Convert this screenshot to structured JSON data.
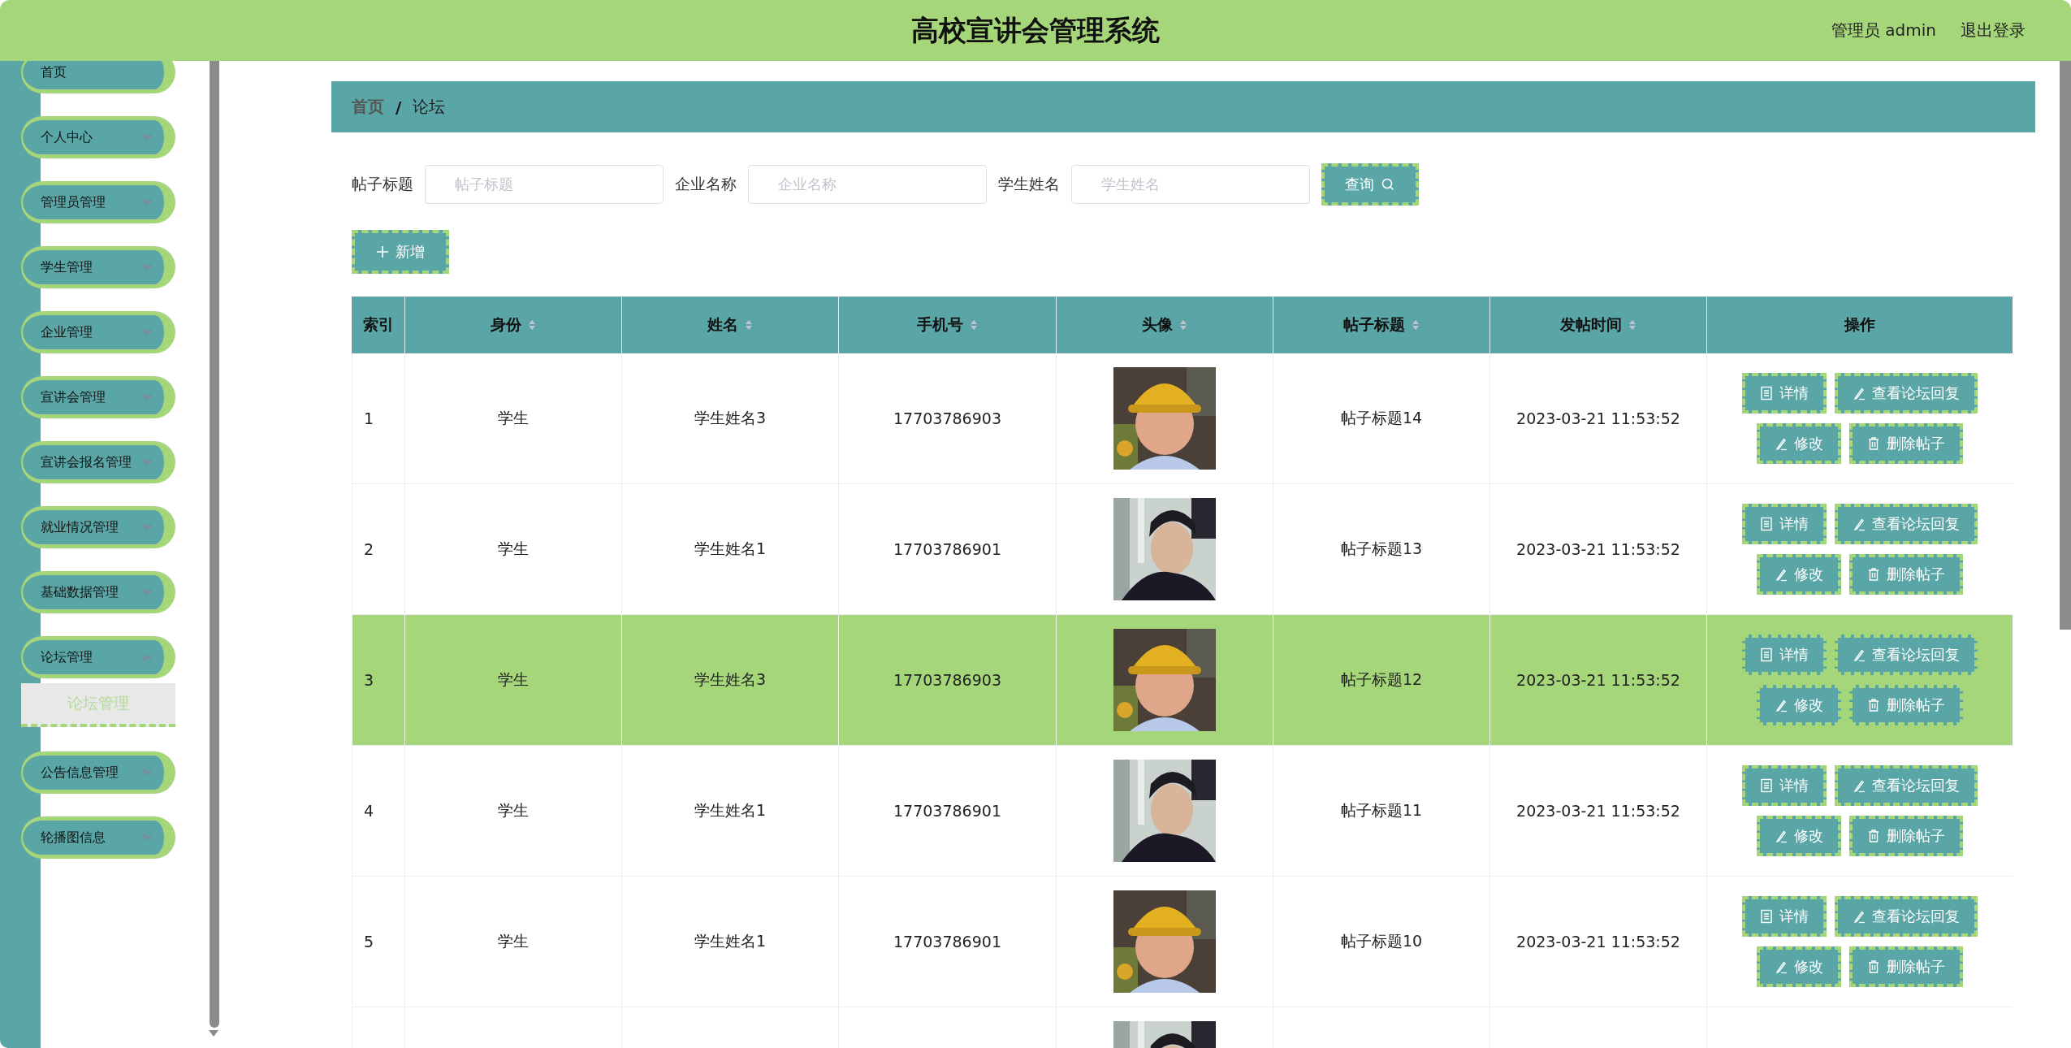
{
  "header": {
    "title": "高校宣讲会管理系统",
    "user": "管理员 admin",
    "logout": "退出登录"
  },
  "sidebar": {
    "items": [
      {
        "label": "首页",
        "kind": "link"
      },
      {
        "label": "个人中心",
        "kind": "menu",
        "expanded": false
      },
      {
        "label": "管理员管理",
        "kind": "menu",
        "expanded": false
      },
      {
        "label": "学生管理",
        "kind": "menu",
        "expanded": false
      },
      {
        "label": "企业管理",
        "kind": "menu",
        "expanded": false
      },
      {
        "label": "宣讲会管理",
        "kind": "menu",
        "expanded": false
      },
      {
        "label": "宣讲会报名管理",
        "kind": "menu",
        "expanded": false
      },
      {
        "label": "就业情况管理",
        "kind": "menu",
        "expanded": false
      },
      {
        "label": "基础数据管理",
        "kind": "menu",
        "expanded": false
      },
      {
        "label": "论坛管理",
        "kind": "menu",
        "expanded": true,
        "children": [
          {
            "label": "论坛管理",
            "selected": true
          }
        ]
      },
      {
        "label": "公告信息管理",
        "kind": "menu",
        "expanded": false
      },
      {
        "label": "轮播图信息",
        "kind": "menu",
        "expanded": false
      }
    ]
  },
  "breadcrumb": {
    "items": [
      "首页",
      "论坛"
    ],
    "separator": "/"
  },
  "search": {
    "fields": [
      {
        "label": "帖子标题",
        "placeholder": "帖子标题"
      },
      {
        "label": "企业名称",
        "placeholder": "企业名称"
      },
      {
        "label": "学生姓名",
        "placeholder": "学生姓名"
      }
    ],
    "button": "查询"
  },
  "add_button": "新增",
  "table": {
    "columns": [
      {
        "label": "索引",
        "sortable": false
      },
      {
        "label": "身份",
        "sortable": true
      },
      {
        "label": "姓名",
        "sortable": true
      },
      {
        "label": "手机号",
        "sortable": true
      },
      {
        "label": "头像",
        "sortable": true
      },
      {
        "label": "帖子标题",
        "sortable": true
      },
      {
        "label": "发帖时间",
        "sortable": true
      },
      {
        "label": "操作",
        "sortable": false
      }
    ],
    "rows": [
      {
        "index": "1",
        "role": "学生",
        "name": "学生姓名3",
        "phone": "17703786903",
        "title": "帖子标题14",
        "time": "2023-03-21 11:53:52",
        "selected": false,
        "actions": [
          {
            "label": "详情",
            "kind": "detail"
          },
          {
            "label": "查看论坛回复",
            "kind": "edit"
          },
          {
            "label": "修改",
            "kind": "edit"
          },
          {
            "label": "删除帖子",
            "kind": "delete"
          }
        ]
      },
      {
        "index": "2",
        "role": "学生",
        "name": "学生姓名1",
        "phone": "17703786901",
        "title": "帖子标题13",
        "time": "2023-03-21 11:53:52",
        "selected": false,
        "actions": [
          {
            "label": "详情",
            "kind": "detail"
          },
          {
            "label": "查看论坛回复",
            "kind": "edit"
          },
          {
            "label": "修改",
            "kind": "edit"
          },
          {
            "label": "删除帖子",
            "kind": "delete"
          }
        ]
      },
      {
        "index": "3",
        "role": "学生",
        "name": "学生姓名3",
        "phone": "17703786903",
        "title": "帖子标题12",
        "time": "2023-03-21 11:53:52",
        "selected": true,
        "actions": [
          {
            "label": "详情",
            "kind": "detail"
          },
          {
            "label": "查看论坛回复",
            "kind": "edit"
          },
          {
            "label": "修改",
            "kind": "edit"
          },
          {
            "label": "删除帖子",
            "kind": "delete"
          }
        ]
      },
      {
        "index": "4",
        "role": "学生",
        "name": "学生姓名1",
        "phone": "17703786901",
        "title": "帖子标题11",
        "time": "2023-03-21 11:53:52",
        "selected": false,
        "actions": [
          {
            "label": "详情",
            "kind": "detail"
          },
          {
            "label": "查看论坛回复",
            "kind": "edit"
          },
          {
            "label": "修改",
            "kind": "edit"
          },
          {
            "label": "删除帖子",
            "kind": "delete"
          }
        ]
      },
      {
        "index": "5",
        "role": "学生",
        "name": "学生姓名1",
        "phone": "17703786901",
        "title": "帖子标题10",
        "time": "2023-03-21 11:53:52",
        "selected": false,
        "actions": [
          {
            "label": "详情",
            "kind": "detail"
          },
          {
            "label": "查看论坛回复",
            "kind": "edit"
          },
          {
            "label": "修改",
            "kind": "edit"
          },
          {
            "label": "删除帖子",
            "kind": "delete"
          }
        ]
      },
      {
        "selected": false
      }
    ]
  }
}
